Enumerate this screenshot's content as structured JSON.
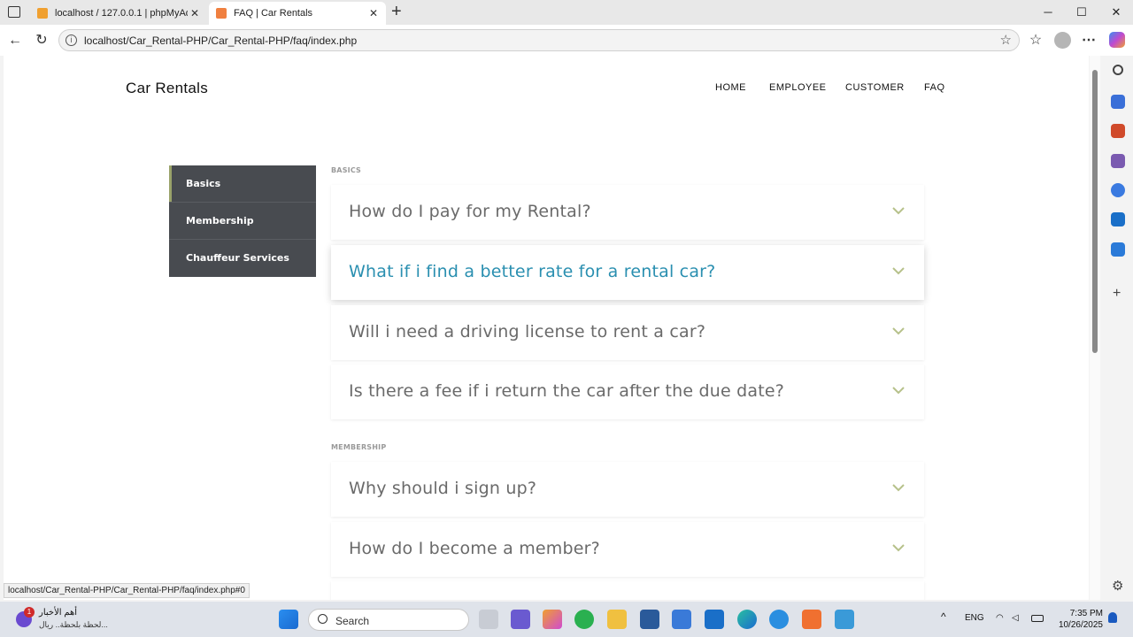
{
  "browser": {
    "tabs": [
      {
        "title": "localhost / 127.0.0.1 | phpMyAdmin",
        "active": false
      },
      {
        "title": "FAQ | Car Rentals",
        "active": true
      }
    ],
    "new_tab_label": "+",
    "url": "localhost/Car_Rental-PHP/Car_Rental-PHP/faq/index.php",
    "status_url": "localhost/Car_Rental-PHP/Car_Rental-PHP/faq/index.php#0"
  },
  "site": {
    "brand": "Car Rentals",
    "nav": [
      "HOME",
      "EMPLOYEE",
      "CUSTOMER",
      "FAQ"
    ]
  },
  "faq": {
    "categories": [
      {
        "label": "Basics",
        "active": true
      },
      {
        "label": "Membership",
        "active": false
      },
      {
        "label": "Chauffeur Services",
        "active": false
      }
    ],
    "sections": [
      {
        "label": "BASICS",
        "questions": [
          "How do I pay for my Rental?",
          "What if i find a better rate for a rental car?",
          "Will i need a driving license to rent a car?",
          "Is there a fee if i return the car after the due date?"
        ]
      },
      {
        "label": "MEMBERSHIP",
        "questions": [
          "Why should i sign up?",
          "How do I become a member?"
        ]
      }
    ],
    "highlighted_question": "What if i find a better rate for a rental car?"
  },
  "taskbar": {
    "news_title": "أهم الأخبار",
    "news_sub": "لحظة بلحظة.. ريال...",
    "news_badge": "1",
    "search_placeholder": "Search",
    "lang": "ENG",
    "time": "7:35 PM",
    "date": "10/26/2025"
  },
  "colors": {
    "accent": "#2a8fb0",
    "sidebar": "#484b50",
    "chevron": "#b6c18a"
  }
}
